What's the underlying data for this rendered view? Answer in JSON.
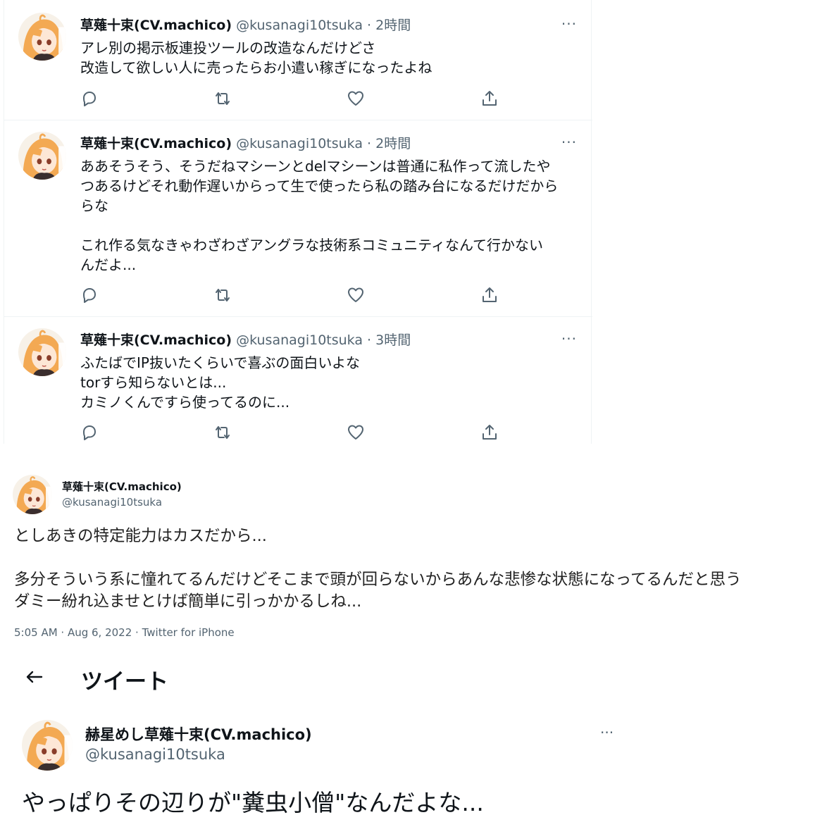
{
  "colors": {
    "text": "#0f1419",
    "secondary": "#536471",
    "border": "#eff3f4",
    "hair": "#f3a953"
  },
  "timeline": {
    "tweets": [
      {
        "name": "草薙十束(CV.machico)",
        "handle": "@kusanagi10tsuka",
        "time": "· 2時間",
        "more": "···",
        "body": "アレ別の掲示板連投ツールの改造なんだけどさ\n改造して欲しい人に売ったらお小遣い稼ぎになったよね"
      },
      {
        "name": "草薙十束(CV.machico)",
        "handle": "@kusanagi10tsuka",
        "time": "· 2時間",
        "more": "···",
        "body": "ああそうそう、そうだねマシーンとdelマシーンは普通に私作って流したや\nつあるけどそれ動作遅いからって生で使ったら私の踏み台になるだけだから\nらな\n\nこれ作る気なきゃわざわざアングラな技術系コミュニティなんて行かない\nんだよ..."
      },
      {
        "name": "草薙十束(CV.machico)",
        "handle": "@kusanagi10tsuka",
        "time": "· 3時間",
        "more": "···",
        "body": "ふたばでIP抜いたくらいで喜ぶの面白いよな\ntorすら知らないとは...\nカミノくんですら使ってるのに..."
      }
    ],
    "action_icons": [
      "reply-icon",
      "retweet-icon",
      "like-icon",
      "share-icon"
    ]
  },
  "detail": {
    "name": "草薙十束(CV.machico)",
    "handle": "@kusanagi10tsuka",
    "body": "としあきの特定能力はカスだから...\n\n多分そういう系に憧れてるんだけどそこまで頭が回らないからあんな悲惨な状態になってるんだと思う\nダミー紛れ込ませとけば簡単に引っかかるしね...",
    "meta": "5:05 AM · Aug 6, 2022 · Twitter for iPhone"
  },
  "page": {
    "title": "ツイート",
    "name": "赫星めし草薙十束(CV.machico)",
    "handle": "@kusanagi10tsuka",
    "more": "···",
    "body": "やっぱりその辺りが\"糞虫小僧\"なんだよな..."
  }
}
